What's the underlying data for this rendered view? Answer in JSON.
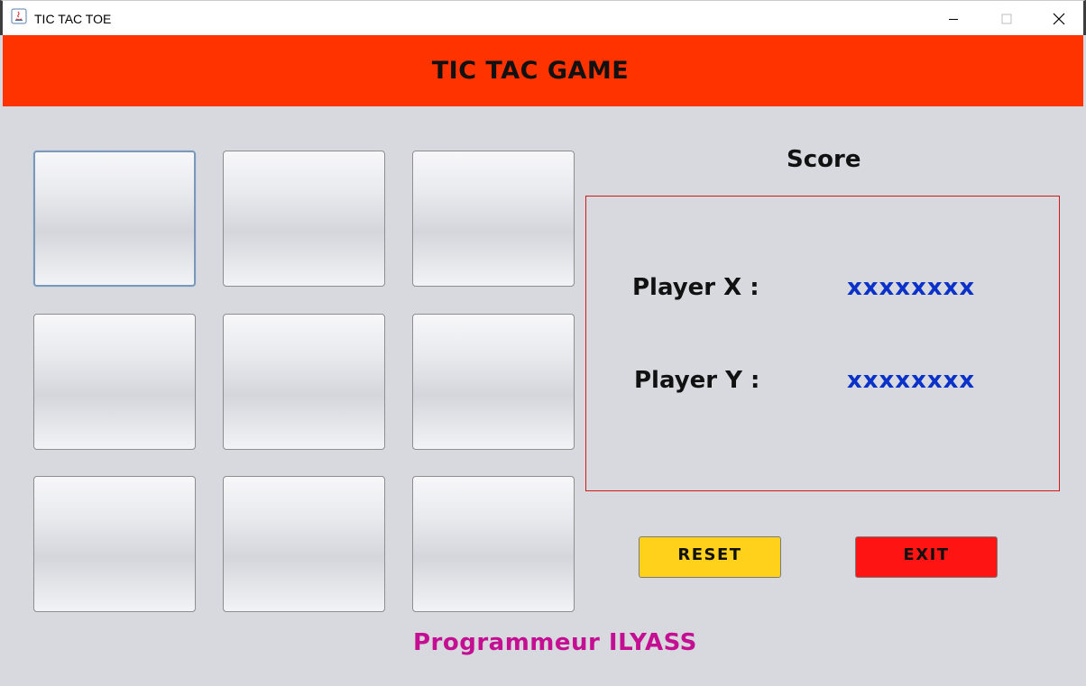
{
  "window": {
    "title": "TIC TAC TOE",
    "minimize_symbol": "—",
    "maximize_symbol": "☐",
    "close_symbol": "✕"
  },
  "header": {
    "title": "TIC TAC GAME"
  },
  "board": {
    "cells": [
      "",
      "",
      "",
      "",
      "",
      "",
      "",
      "",
      ""
    ]
  },
  "score": {
    "title": "Score",
    "players": [
      {
        "label": "Player X :",
        "value": "xxxxxxxx"
      },
      {
        "label": "Player Y :",
        "value": "xxxxxxxx"
      }
    ]
  },
  "actions": {
    "reset_label": "RESET",
    "exit_label": "EXIT"
  },
  "footer": {
    "credit": "Programmeur ILYASS"
  },
  "colors": {
    "banner": "#ff3300",
    "reset": "#ffd11a",
    "exit": "#ff1414",
    "score_value": "#0a31c8",
    "credit": "#c50f93",
    "score_border": "#d21a1a"
  }
}
